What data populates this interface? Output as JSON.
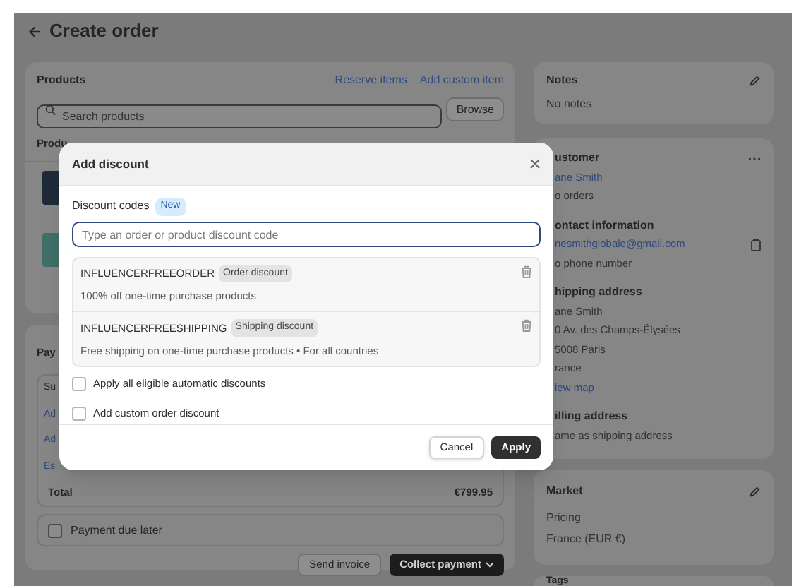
{
  "page": {
    "title": "Create order"
  },
  "products": {
    "title": "Products",
    "links": [
      "Reserve items",
      "Add custom item"
    ],
    "search": {
      "placeholder": "Search products"
    },
    "browse": "Browse",
    "column_1": "Produ"
  },
  "payment": {
    "title": "Pay",
    "rows": [
      {
        "kind": "text",
        "label": "Su"
      },
      {
        "kind": "link",
        "label": "Ad"
      },
      {
        "kind": "link",
        "label": "Ad"
      },
      {
        "kind": "link",
        "label": "Es"
      }
    ],
    "total": {
      "label": "Total",
      "value": "€799.95"
    },
    "due_later": {
      "label": "Payment due later",
      "checked": false
    },
    "buttons": [
      {
        "label": "Send invoice",
        "kind": "secondary"
      },
      {
        "label": "Collect payment",
        "kind": "primary"
      }
    ]
  },
  "notes": {
    "title": "Notes",
    "text": "No notes"
  },
  "customer": {
    "lines": [
      {
        "kind": "heading",
        "text": "ustomer",
        "more": true
      },
      {
        "kind": "link",
        "text": "ane Smith"
      },
      {
        "kind": "text",
        "text": "o orders"
      },
      {
        "kind": "heading",
        "text": "ontact information"
      },
      {
        "kind": "link",
        "text": "nesmithglobale@gmail.com",
        "copy": true
      },
      {
        "kind": "text",
        "text": "o phone number"
      },
      {
        "kind": "heading",
        "text": "hipping address"
      },
      {
        "kind": "text",
        "text": "ane Smith"
      },
      {
        "kind": "text",
        "text": "0 Av. des Champs-Élysées"
      },
      {
        "kind": "text",
        "text": "5008 Paris"
      },
      {
        "kind": "text",
        "text": "rance"
      },
      {
        "kind": "link",
        "text": "iew map"
      },
      {
        "kind": "heading",
        "text": "illing address"
      },
      {
        "kind": "text",
        "text": "ame as shipping address"
      }
    ]
  },
  "market": {
    "title": "Market",
    "lines": [
      "Pricing",
      "France (EUR €)"
    ]
  },
  "tags": {
    "title": "Tags"
  },
  "modal": {
    "title": "Add discount",
    "codes_label": "Discount codes",
    "badge": "New",
    "input": {
      "placeholder": "Type an order or product discount code"
    },
    "codes": [
      {
        "code": "INFLUENCERFREEORDER",
        "tag": "Order discount",
        "description": "100% off one-time purchase products"
      },
      {
        "code": "INFLUENCERFREESHIPPING",
        "tag": "Shipping discount",
        "description": "Free shipping on one-time purchase products • For all countries"
      }
    ],
    "options": [
      {
        "label": "Apply all eligible automatic discounts",
        "checked": false
      },
      {
        "label": "Add custom order discount",
        "checked": false
      }
    ],
    "cancel": "Cancel",
    "apply": "Apply"
  }
}
